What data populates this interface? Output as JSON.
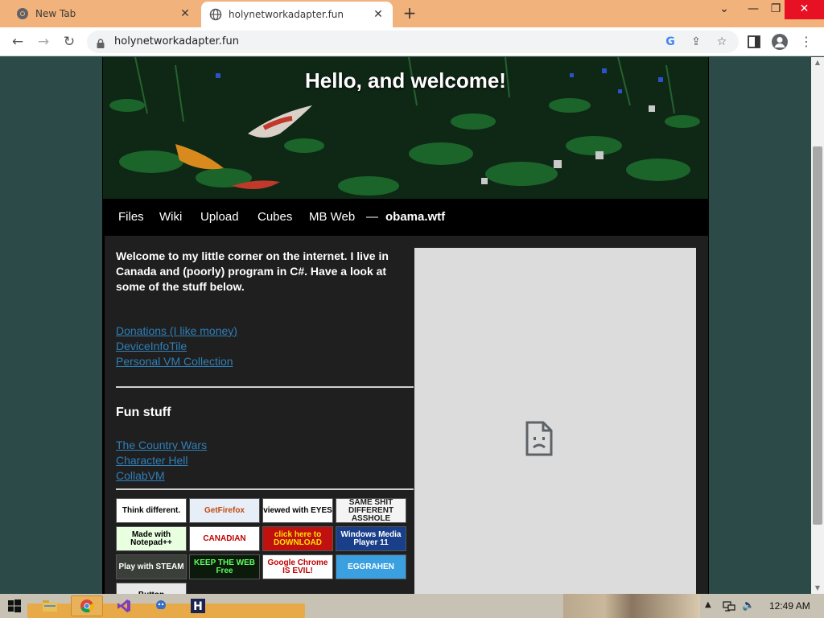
{
  "browser": {
    "tabs": [
      {
        "title": "New Tab",
        "active": false,
        "icon": "chrome-icon"
      },
      {
        "title": "holynetworkadapter.fun",
        "active": true,
        "icon": "globe-icon"
      }
    ],
    "url": "holynetworkadapter.fun",
    "tab_close_glyph": "✕",
    "new_tab_glyph": "+"
  },
  "site": {
    "title": "Hello, and welcome!",
    "nav": [
      "Files",
      "Wiki",
      "Upload",
      "Cubes",
      "MB Web",
      "—",
      "obama.wtf"
    ],
    "intro": "Welcome to my little corner on the internet. I live in Canada and (poorly) program in C#. Have a look at some of the stuff below.",
    "links": [
      "Donations (I like money)",
      "DeviceInfoTile",
      "Personal VM Collection"
    ],
    "fun_heading": "Fun stuff",
    "fun_links": [
      "The Country Wars",
      "Character Hell",
      "CollabVM"
    ],
    "buttons88": [
      {
        "text": "Think different.",
        "bg": "#ffffff",
        "fg": "#000000"
      },
      {
        "text": "GetFirefox",
        "bg": "#e8eef8",
        "fg": "#c04a10"
      },
      {
        "text": "viewed with EYES",
        "bg": "#ffffff",
        "fg": "#000000"
      },
      {
        "text": "SAME SHIT DIFFERENT ASSHOLE",
        "bg": "#f4f4f4",
        "fg": "#222222"
      },
      {
        "text": "Made with Notepad++",
        "bg": "#e8ffe0",
        "fg": "#000000"
      },
      {
        "text": "CANADIAN",
        "bg": "#ffffff",
        "fg": "#c00000"
      },
      {
        "text": "click here to DOWNLOAD",
        "bg": "#c01010",
        "fg": "#ffe000"
      },
      {
        "text": "Windows Media Player 11",
        "bg": "#1a3f8a",
        "fg": "#ffffff"
      },
      {
        "text": "Play with STEAM",
        "bg": "#3a3f3a",
        "fg": "#ffffff"
      },
      {
        "text": "KEEP THE WEB Free",
        "bg": "#0b1a0b",
        "fg": "#5cff5c"
      },
      {
        "text": "Google Chrome IS EVIL!",
        "bg": "#ffffff",
        "fg": "#c00000"
      },
      {
        "text": "EGGRAHEN",
        "bg": "#3aa0e0",
        "fg": "#ffffff"
      },
      {
        "text": "Button",
        "bg": "#e8e8e8",
        "fg": "#000000"
      }
    ]
  },
  "taskbar": {
    "clock": "12:49 AM",
    "apps": [
      "file-explorer-icon",
      "chrome-icon",
      "visual-studio-icon",
      "app-icon",
      "app-h-icon"
    ]
  }
}
